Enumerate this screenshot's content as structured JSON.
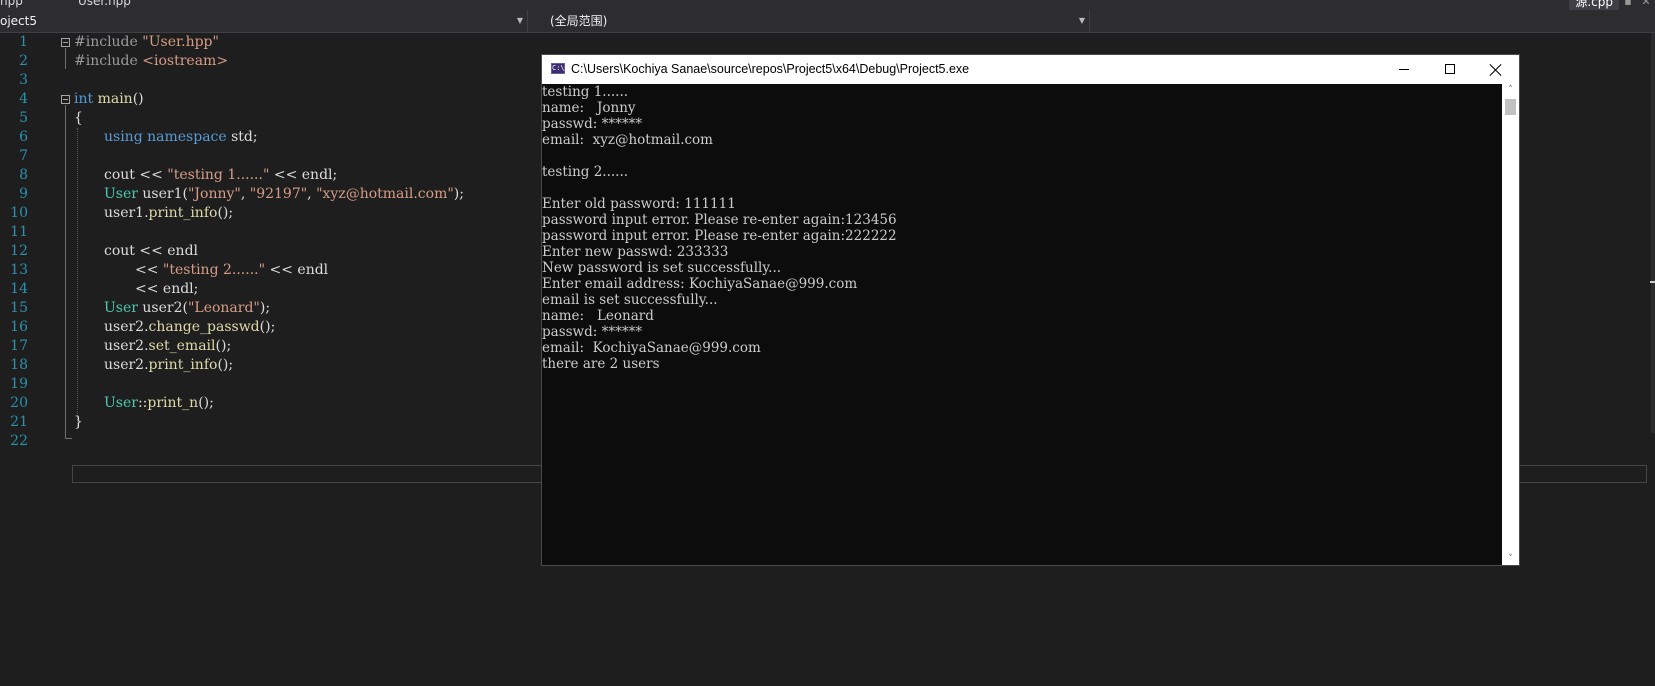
{
  "tabs": {
    "left_tab_1": "hpp",
    "left_tab_2": "User.hpp",
    "right_tab": "源.cpp",
    "pin_icon": "pin-icon",
    "close_icon": "close-icon"
  },
  "navbar": {
    "project": "oject5",
    "scope": "(全局范围)",
    "member": ""
  },
  "editor": {
    "line_numbers": [
      "1",
      "2",
      "3",
      "4",
      "5",
      "6",
      "7",
      "8",
      "9",
      "10",
      "11",
      "12",
      "13",
      "14",
      "15",
      "16",
      "17",
      "18",
      "19",
      "20",
      "21",
      "22"
    ],
    "code": {
      "l1_pp": "#include",
      "l1_str": "\"User.hpp\"",
      "l2_pp": "#include",
      "l2_str": "<iostream>",
      "l4_kw": "int",
      "l4_fn": "main",
      "l4_rest": "()",
      "l5": "{",
      "l6_kw1": "using",
      "l6_kw2": "namespace",
      "l6_rest": "std;",
      "l8_a": "cout << ",
      "l8_str": "\"testing 1......\"",
      "l8_b": " << endl;",
      "l9_cls": "User",
      "l9_a": " user1(",
      "l9_s1": "\"Jonny\"",
      "l9_sep1": ", ",
      "l9_s2": "\"92197\"",
      "l9_sep2": ", ",
      "l9_s3": "\"xyz@hotmail.com\"",
      "l9_b": ");",
      "l10_a": "user1.",
      "l10_fn": "print_info",
      "l10_b": "();",
      "l12": "cout << endl",
      "l13_a": "<< ",
      "l13_str": "\"testing 2......\"",
      "l13_b": " << endl",
      "l14": "<< endl;",
      "l15_cls": "User",
      "l15_a": " user2(",
      "l15_str": "\"Leonard\"",
      "l15_b": ");",
      "l16_a": "user2.",
      "l16_fn": "change_passwd",
      "l16_b": "();",
      "l17_a": "user2.",
      "l17_fn": "set_email",
      "l17_b": "();",
      "l18_a": "user2.",
      "l18_fn": "print_info",
      "l18_b": "();",
      "l20_cls": "User",
      "l20_a": "::",
      "l20_fn": "print_n",
      "l20_b": "();",
      "l21": "}"
    }
  },
  "console": {
    "icon_label": "C:\\",
    "title": "C:\\Users\\Kochiya Sanae\\source\\repos\\Project5\\x64\\Debug\\Project5.exe",
    "output": [
      "testing 1......",
      "name:   Jonny",
      "passwd: ******",
      "email:  xyz@hotmail.com",
      "",
      "testing 2......",
      "",
      "Enter old password: 111111",
      "password input error. Please re-enter again:123456",
      "password input error. Please re-enter again:222222",
      "Enter new passwd: 233333",
      "New password is set successfully...",
      "Enter email address: KochiyaSanae@999.com",
      "email is set successfully...",
      "name:   Leonard",
      "passwd: ******",
      "email:  KochiyaSanae@999.com",
      "there are 2 users"
    ],
    "scroll_up_glyph": "˄",
    "scroll_down_glyph": "˅"
  },
  "colors": {
    "editor_bg": "#1e1e1e",
    "keyword": "#569cd6",
    "string": "#d69d85",
    "type": "#4ec9b0",
    "function": "#dcdcaa",
    "line_number": "#2b91af",
    "console_bg": "#0c0c0c"
  }
}
